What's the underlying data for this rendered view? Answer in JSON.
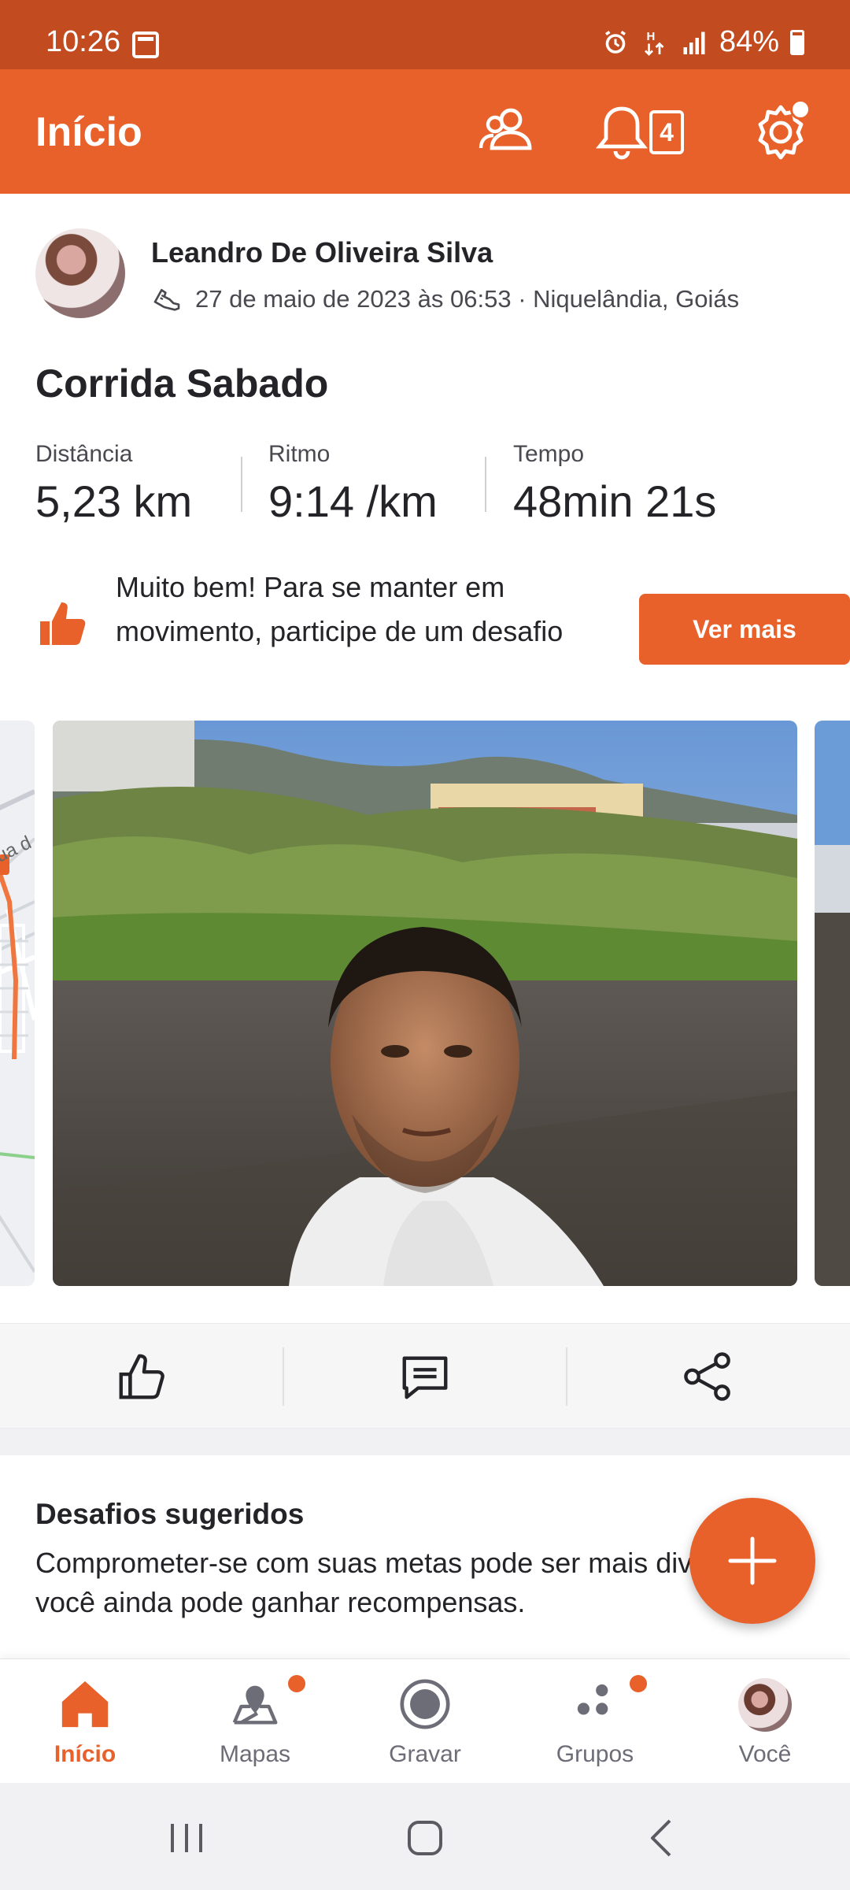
{
  "status_bar": {
    "time": "10:26",
    "battery": "84%"
  },
  "header": {
    "title": "Início",
    "notification_count": "4"
  },
  "post": {
    "author": "Leandro De Oliveira Silva",
    "meta": "27 de maio de 2023 às 06:53 · Niquelândia, Goiás",
    "title": "Corrida Sabado",
    "stats": [
      {
        "label": "Distância",
        "value": "5,23 km"
      },
      {
        "label": "Ritmo",
        "value": "9:14 /km"
      },
      {
        "label": "Tempo",
        "value": "48min 21s"
      }
    ],
    "promo_text": "Muito bem! Para se manter em movimento, participe de um desafio",
    "promo_button": "Ver mais",
    "map_label": "ua d"
  },
  "suggested": {
    "title": "Desafios sugeridos",
    "text": "Comprometer-se com suas metas pode ser mais divertido, e você ainda pode ganhar recompensas."
  },
  "bottom_nav": [
    {
      "label": "Início",
      "icon": "home-icon",
      "active": true
    },
    {
      "label": "Mapas",
      "icon": "map-pin-icon",
      "active": false
    },
    {
      "label": "Gravar",
      "icon": "record-icon",
      "active": false
    },
    {
      "label": "Grupos",
      "icon": "groups-icon",
      "active": false
    },
    {
      "label": "Você",
      "icon": "avatar",
      "active": false
    }
  ],
  "colors": {
    "brand": "#e8602a",
    "status_bar": "#c24b1f",
    "text": "#242428"
  }
}
